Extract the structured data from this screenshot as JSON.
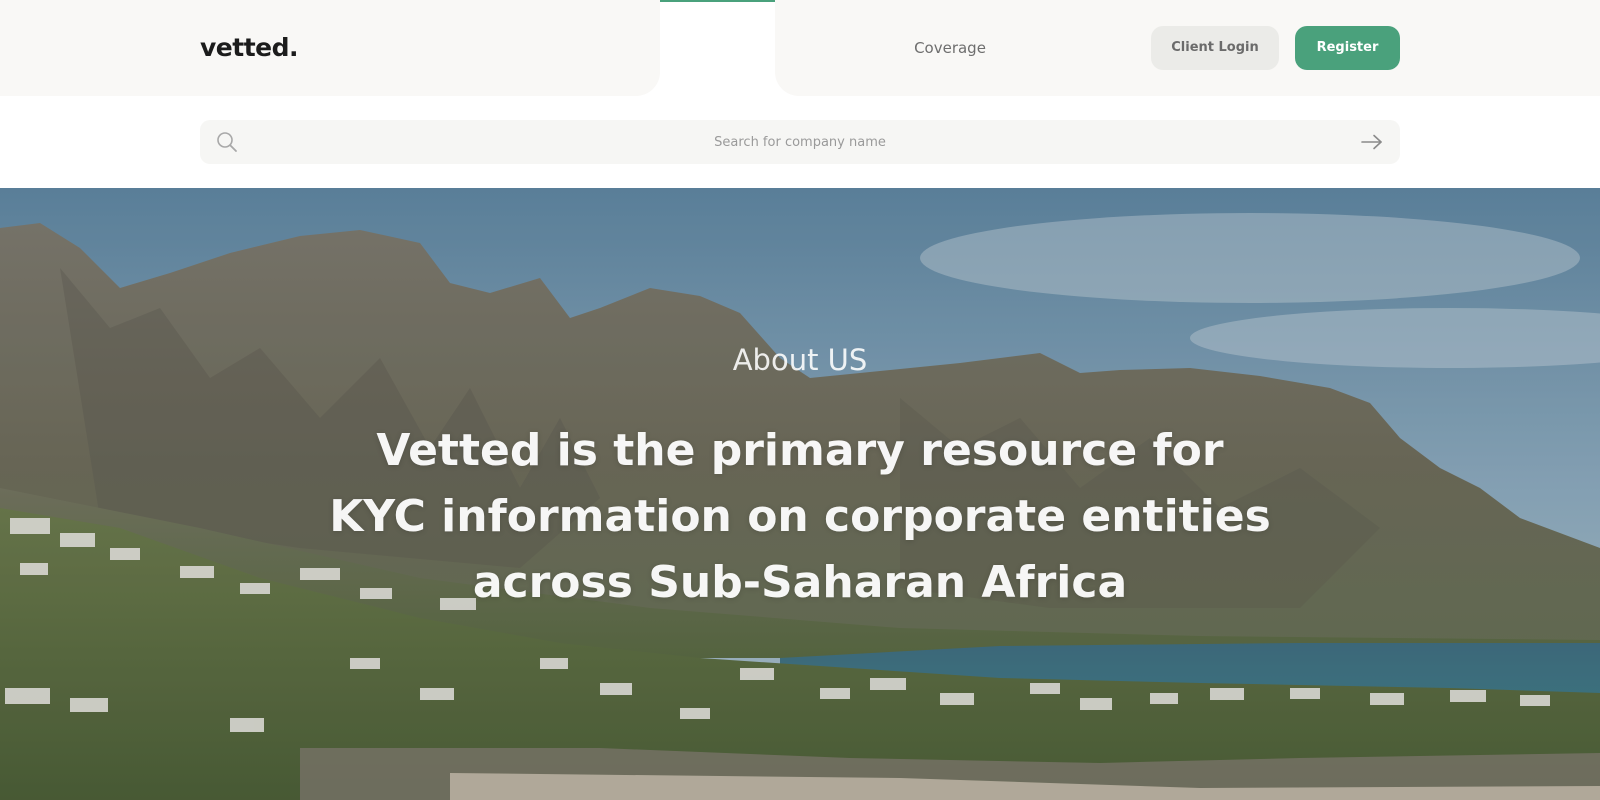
{
  "header": {
    "logo": "vetted.",
    "nav": {
      "coverage_label": "Coverage"
    },
    "client_login_label": "Client Login",
    "register_label": "Register",
    "accent_color": "#4aa17c"
  },
  "search": {
    "placeholder": "Search for company name",
    "value": "",
    "icon": "search-icon",
    "submit_icon": "arrow-right-icon"
  },
  "hero": {
    "subtitle": "About US",
    "title_lines": [
      "Vetted is the primary resource for",
      "KYC information on corporate entities",
      "across Sub-Saharan Africa"
    ]
  }
}
